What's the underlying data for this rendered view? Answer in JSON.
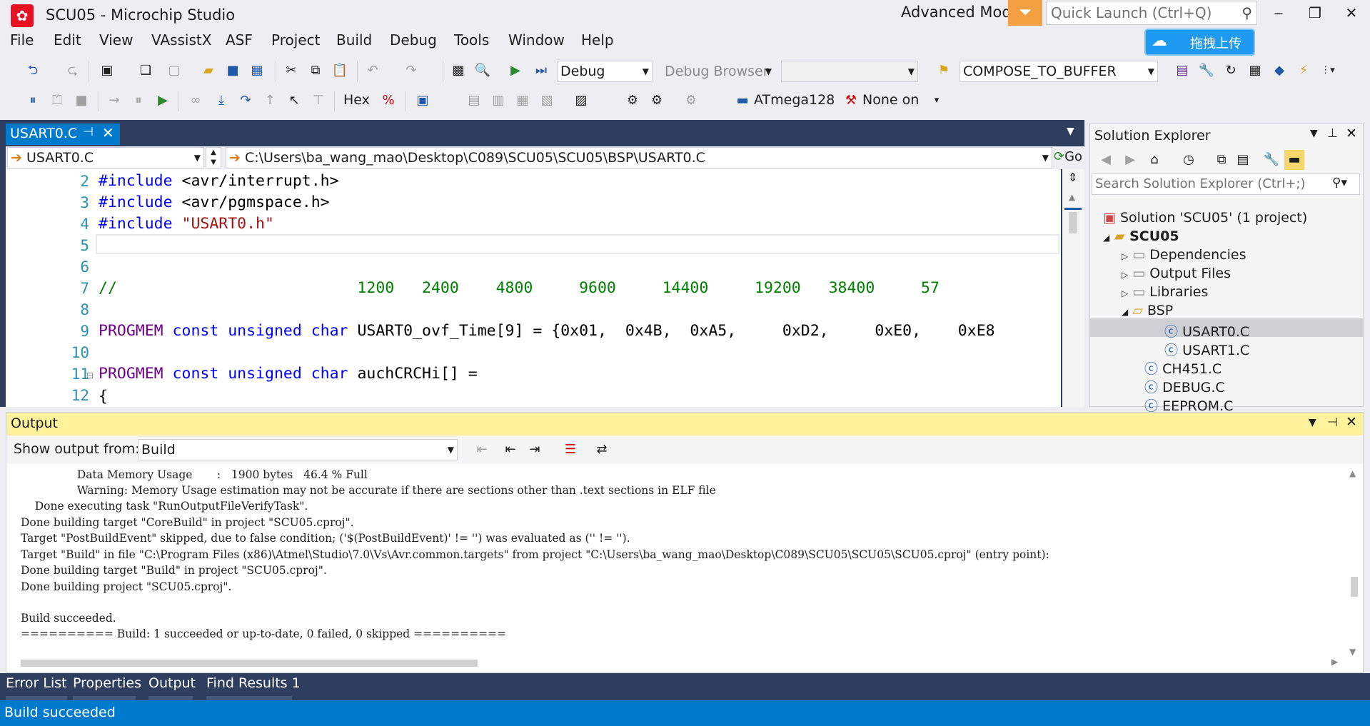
{
  "title_bar": {
    "title": "SCU05 - Microchip Studio",
    "mode": "Advanced Mode",
    "quick_launch_placeholder": "Quick Launch (Ctrl+Q)",
    "minimize": "‒",
    "restore": "❐",
    "close": "✕",
    "cloud_button_label": "拖拽上传",
    "accent": "#f2a041"
  },
  "menu": [
    "File",
    "Edit",
    "View",
    "VAssistX",
    "ASF",
    "Project",
    "Build",
    "Debug",
    "Tools",
    "Window",
    "Help"
  ],
  "toolbar": {
    "configuration": "Debug",
    "debug_browser": "Debug Browser",
    "empty_combo": "",
    "function_combo": "COMPOSE_TO_BUFFER",
    "hex_label": "Hex",
    "device": "ATmega128",
    "tool": "None on"
  },
  "editor": {
    "tab_label": "USART0.C",
    "file_combo": "USART0.C",
    "path_combo": "C:\\Users\\ba_wang_mao\\Desktop\\C089\\SCU05\\SCU05\\BSP\\USART0.C",
    "go_label": "Go",
    "line_numbers": [
      "2",
      "3",
      "4",
      "5",
      "6",
      "7",
      "8",
      "9",
      "10",
      "11",
      "12"
    ],
    "lines": {
      "l2_directive": "#include",
      "l2_arg": " <avr/interrupt.h>",
      "l3_directive": "#include",
      "l3_arg": " <avr/pgmspace.h>",
      "l4_directive": "#include",
      "l4_arg": " \"USART0.h\"",
      "l7_comment": "//                          1200   2400    4800     9600     14400     19200   38400     57",
      "l9_macro": "PROGMEM",
      "l9_kw": " const unsigned char",
      "l9_rest": " USART0_ovf_Time[9] = {0x01,  0x4B,  0xA5,     0xD2,     0xE0,    0xE8",
      "l11_macro": "PROGMEM",
      "l11_kw": " const unsigned char",
      "l11_rest": " auchCRCHi[] =",
      "l12": "{"
    }
  },
  "solution_explorer": {
    "title": "Solution Explorer",
    "search_placeholder": "Search Solution Explorer (Ctrl+;)",
    "items": [
      {
        "label": "Solution 'SCU05' (1 project)",
        "icon": "solution-icon"
      },
      {
        "label": "SCU05",
        "icon": "project-icon"
      },
      {
        "label": "Dependencies",
        "icon": "folder-icon"
      },
      {
        "label": "Output Files",
        "icon": "folder-icon"
      },
      {
        "label": "Libraries",
        "icon": "folder-icon"
      },
      {
        "label": "BSP",
        "icon": "folder-open-icon"
      },
      {
        "label": "USART0.C",
        "icon": "c-file-icon"
      },
      {
        "label": "USART1.C",
        "icon": "c-file-icon"
      },
      {
        "label": "CH451.C",
        "icon": "c-file-icon"
      },
      {
        "label": "DEBUG.C",
        "icon": "c-file-icon"
      },
      {
        "label": "EEPROM.C",
        "icon": "c-file-icon"
      }
    ]
  },
  "output": {
    "title": "Output",
    "show_from_label": "Show output from:",
    "source": "Build",
    "lines": [
      "                Data Memory Usage       :   1900 bytes   46.4 % Full",
      "                Warning: Memory Usage estimation may not be accurate if there are sections other than .text sections in ELF file",
      "    Done executing task \"RunOutputFileVerifyTask\".",
      "Done building target \"CoreBuild\" in project \"SCU05.cproj\".",
      "Target \"PostBuildEvent\" skipped, due to false condition; ('$(PostBuildEvent)' != '') was evaluated as ('' != '').",
      "Target \"Build\" in file \"C:\\Program Files (x86)\\Atmel\\Studio\\7.0\\Vs\\Avr.common.targets\" from project \"C:\\Users\\ba_wang_mao\\Desktop\\C089\\SCU05\\SCU05\\SCU05.cproj\" (entry point):",
      "Done building target \"Build\" in project \"SCU05.cproj\".",
      "Done building project \"SCU05.cproj\".",
      "",
      "Build succeeded.",
      "========== Build: 1 succeeded or up-to-date, 0 failed, 0 skipped =========="
    ]
  },
  "bottom_tabs": [
    "Error List",
    "Properties",
    "Output",
    "Find Results 1"
  ],
  "status": "Build succeeded"
}
